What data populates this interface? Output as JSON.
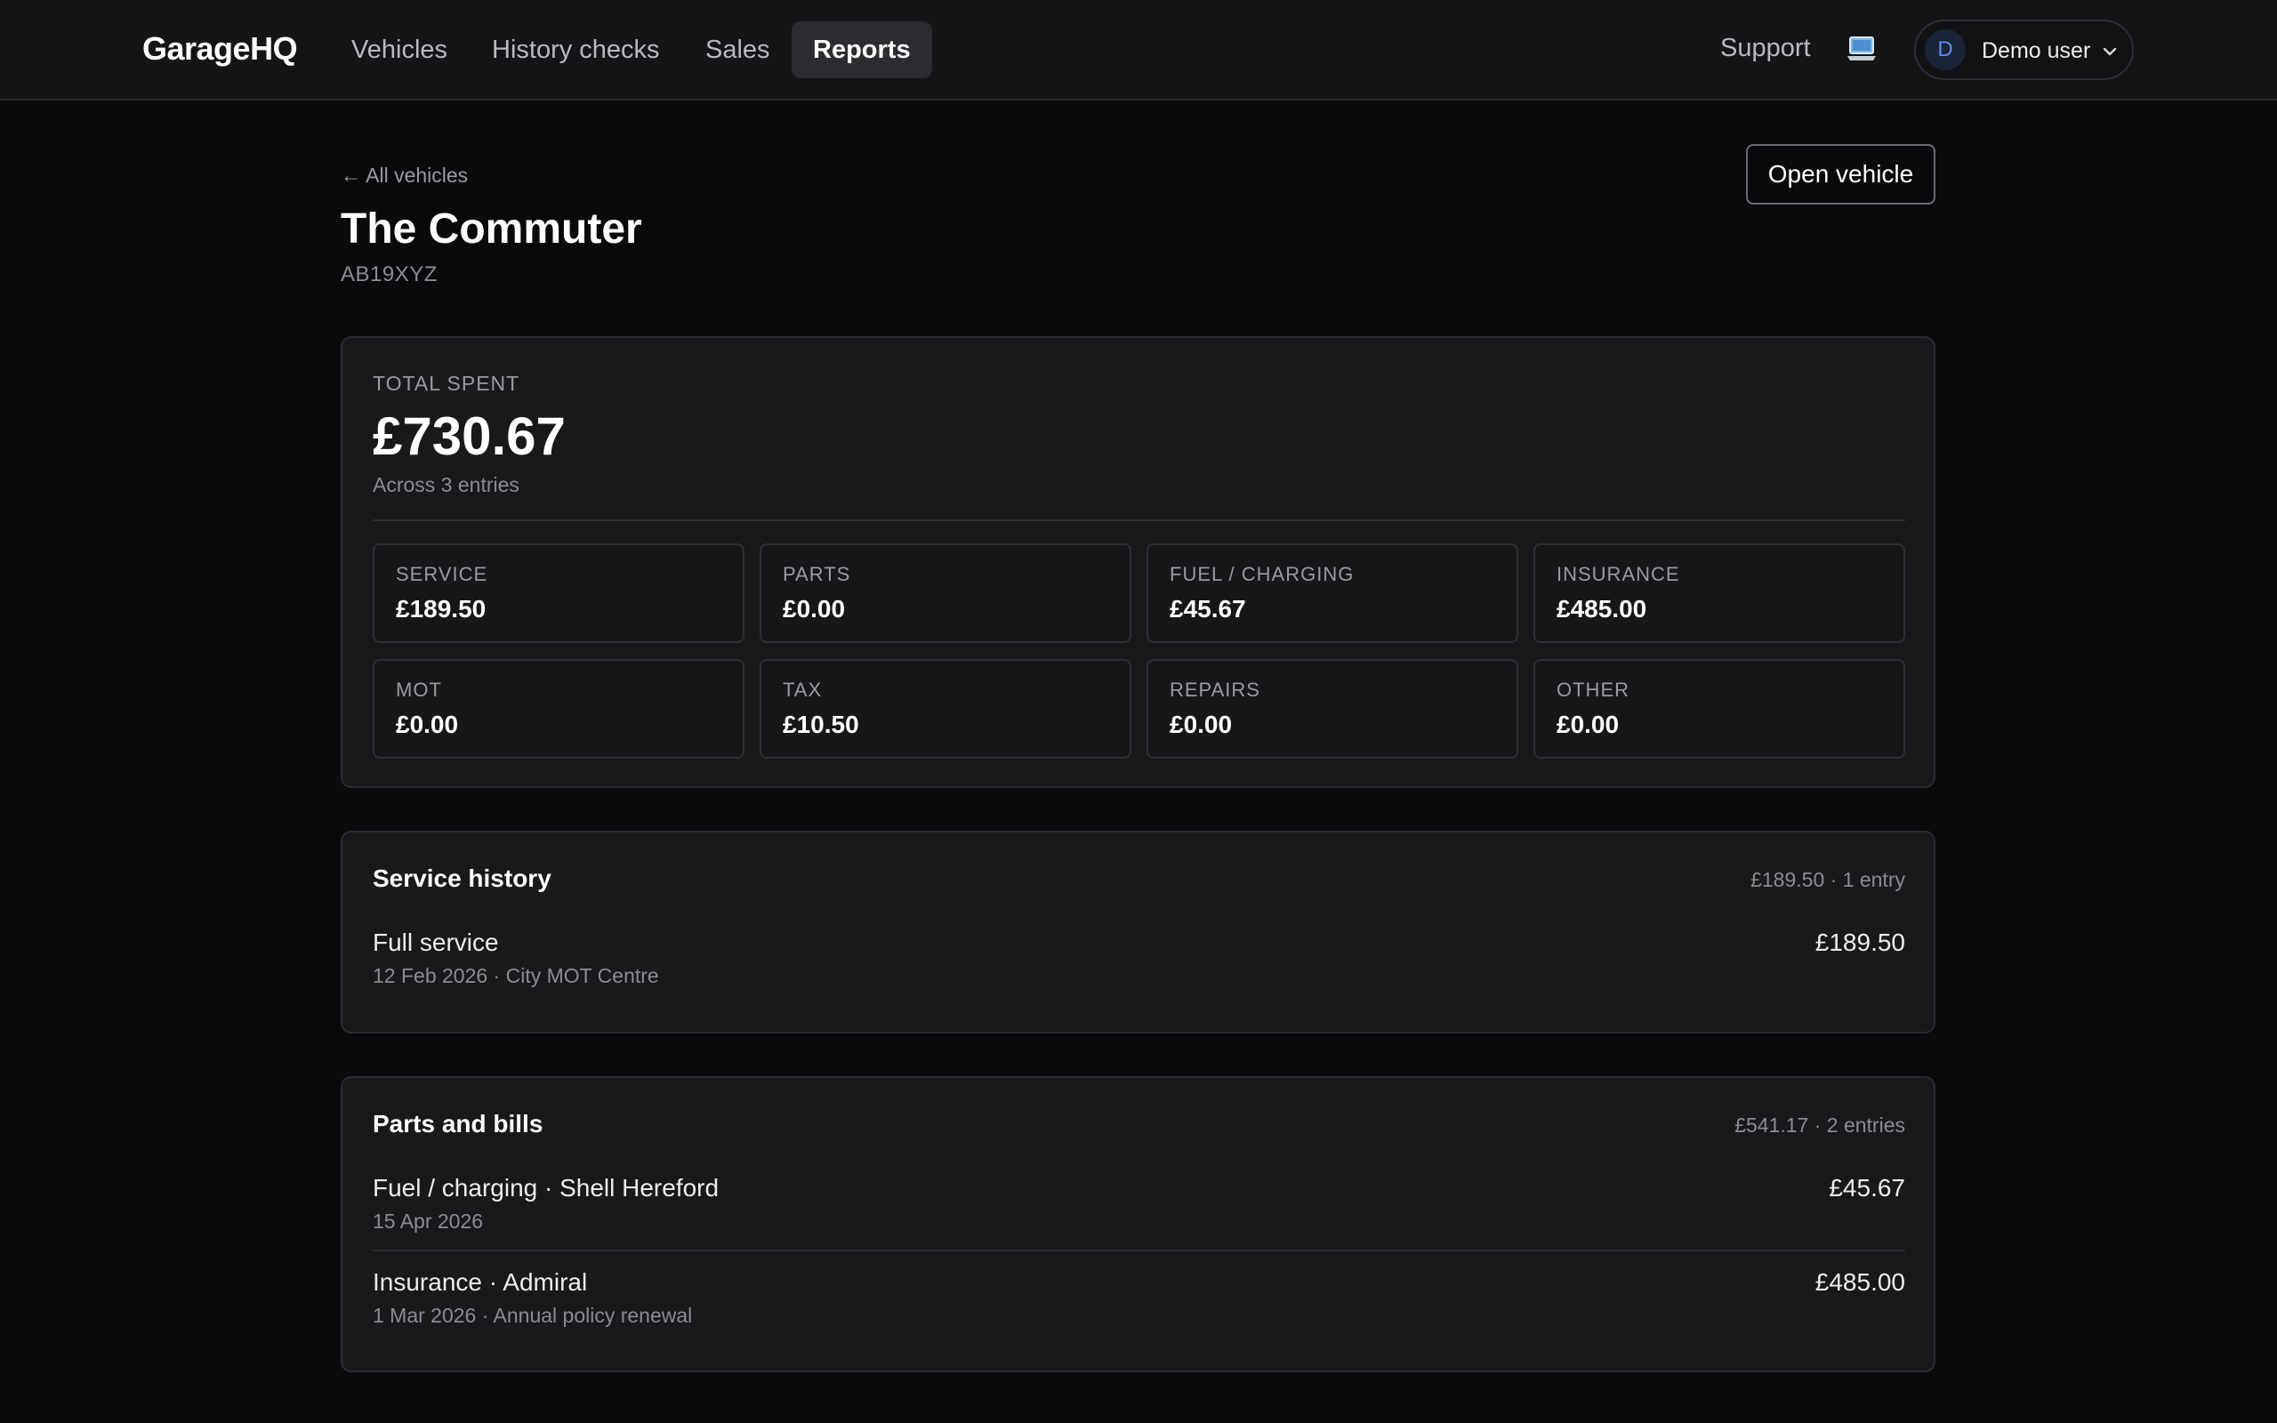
{
  "nav": {
    "brand": "GarageHQ",
    "links": [
      "Vehicles",
      "History checks",
      "Sales",
      "Reports"
    ],
    "active": "Reports",
    "support": "Support",
    "user": {
      "initial": "D",
      "name": "Demo user"
    }
  },
  "header": {
    "back": "← All vehicles",
    "title": "The Commuter",
    "registration": "AB19XYZ",
    "open_button": "Open vehicle"
  },
  "summary": {
    "label": "TOTAL SPENT",
    "total": "£730.67",
    "note": "Across 3 entries",
    "categories": [
      {
        "label": "SERVICE",
        "value": "£189.50"
      },
      {
        "label": "PARTS",
        "value": "£0.00"
      },
      {
        "label": "FUEL / CHARGING",
        "value": "£45.67"
      },
      {
        "label": "INSURANCE",
        "value": "£485.00"
      },
      {
        "label": "MOT",
        "value": "£0.00"
      },
      {
        "label": "TAX",
        "value": "£10.50"
      },
      {
        "label": "REPAIRS",
        "value": "£0.00"
      },
      {
        "label": "OTHER",
        "value": "£0.00"
      }
    ]
  },
  "service_history": {
    "title": "Service history",
    "meta": "£189.50 · 1 entry",
    "entries": [
      {
        "title": "Full service",
        "sub": "12 Feb 2026 · City MOT Centre",
        "amount": "£189.50"
      }
    ]
  },
  "parts_bills": {
    "title": "Parts and bills",
    "meta": "£541.17 · 2 entries",
    "entries": [
      {
        "title": "Fuel / charging · Shell Hereford",
        "sub": "15 Apr 2026",
        "amount": "£45.67"
      },
      {
        "title": "Insurance · Admiral",
        "sub": "1 Mar 2026 · Annual policy renewal",
        "amount": "£485.00"
      }
    ]
  }
}
